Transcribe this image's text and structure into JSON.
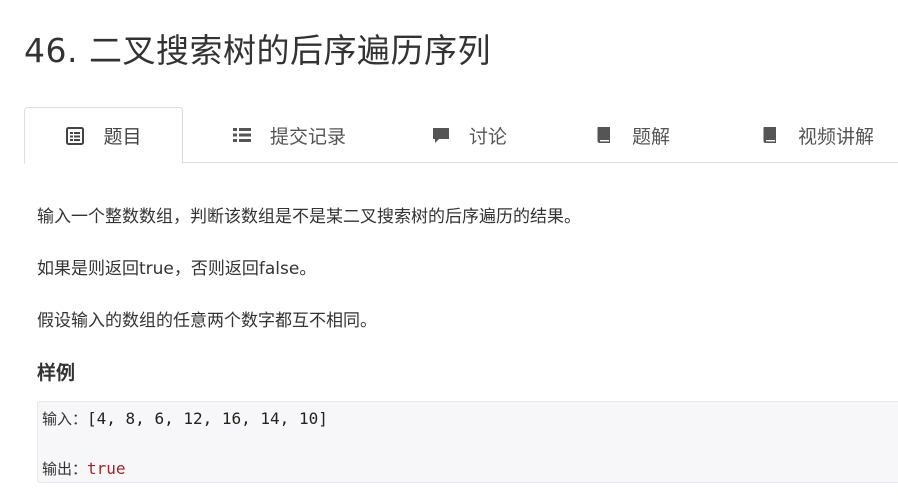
{
  "problem": {
    "title": "46. 二叉搜索树的后序遍历序列"
  },
  "tabs": [
    {
      "label": "题目",
      "icon": "document-list-icon",
      "active": true
    },
    {
      "label": "提交记录",
      "icon": "list-icon",
      "active": false
    },
    {
      "label": "讨论",
      "icon": "chat-bubble-icon",
      "active": false
    },
    {
      "label": "题解",
      "icon": "book-icon",
      "active": false
    },
    {
      "label": "视频讲解",
      "icon": "book-icon",
      "active": false
    }
  ],
  "description": {
    "paragraphs": [
      "输入一个整数数组，判断该数组是不是某二叉搜索树的后序遍历的结果。",
      "如果是则返回true，否则返回false。",
      "假设输入的数组的任意两个数字都互不相同。"
    ]
  },
  "sample": {
    "heading": "样例",
    "input_label": "输入：",
    "input_value": "[4, 8, 6, 12, 16, 14, 10]",
    "output_label": "输出：",
    "output_value": "true"
  },
  "colors": {
    "text": "#333333",
    "tab_border": "#dddddd",
    "sample_bg": "#f7f7f9",
    "output_value": "#a0262c"
  }
}
